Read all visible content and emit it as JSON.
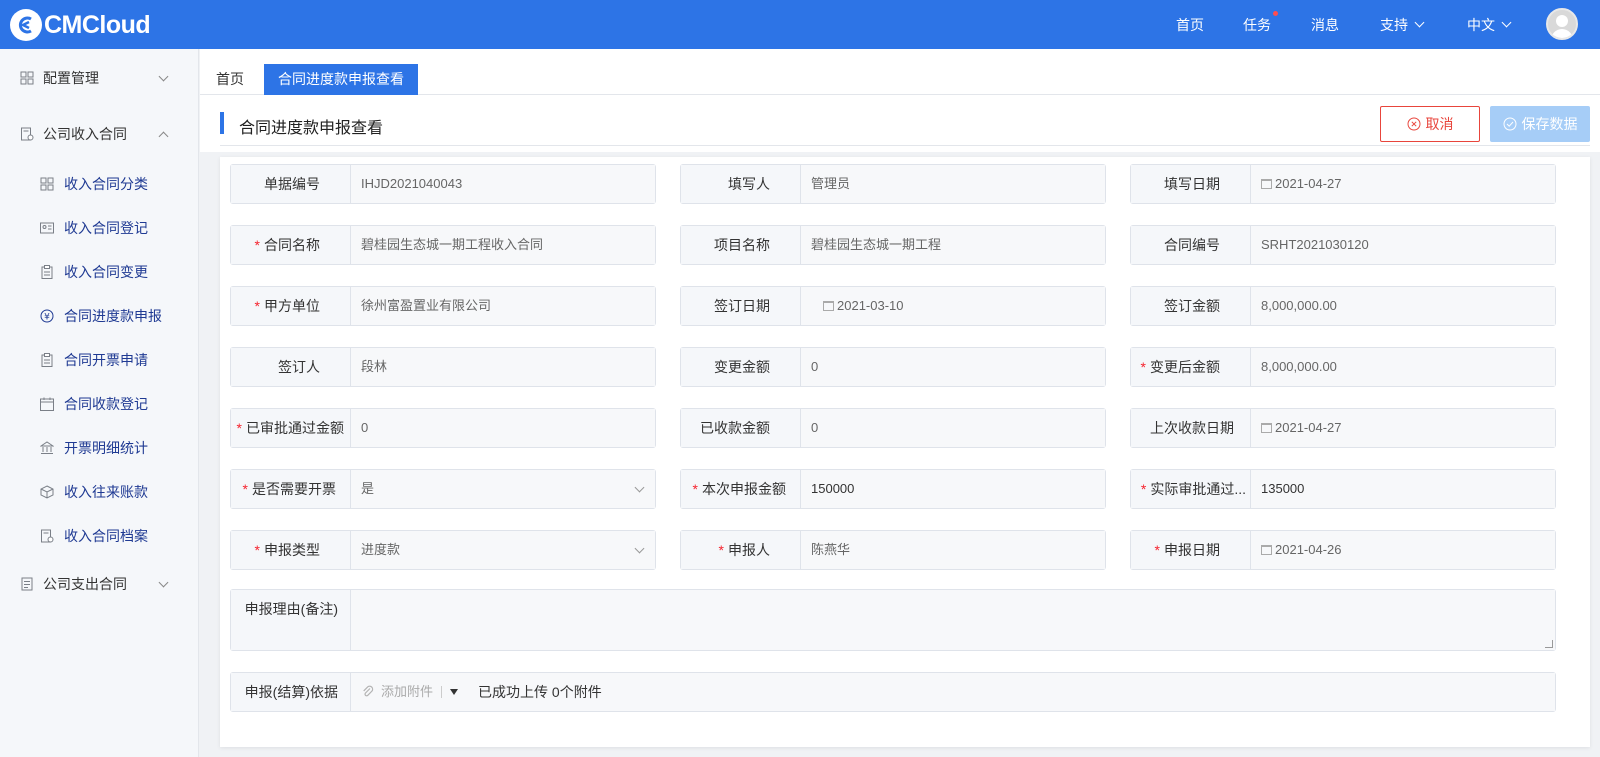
{
  "app": {
    "brand": "CMCloud"
  },
  "topnav": {
    "home": "首页",
    "tasks": "任务",
    "messages": "消息",
    "support": "支持",
    "language": "中文"
  },
  "sidebar": {
    "group1": "配置管理",
    "group2": "公司收入合同",
    "items": [
      "收入合同分类",
      "收入合同登记",
      "收入合同变更",
      "合同进度款申报",
      "合同开票申请",
      "合同收款登记",
      "开票明细统计",
      "收入往来账款",
      "收入合同档案"
    ],
    "group3": "公司支出合同"
  },
  "tabs": {
    "home": "首页",
    "active": "合同进度款申报查看"
  },
  "page": {
    "title": "合同进度款申报查看",
    "cancel": "取消",
    "save": "保存数据"
  },
  "form": {
    "doc_no_label": "单据编号",
    "doc_no": "IHJD2021040043",
    "writer_label": "填写人",
    "writer": "管理员",
    "write_date_label": "填写日期",
    "write_date": "2021-04-27",
    "contract_name_label": "合同名称",
    "contract_name": "碧桂园生态城一期工程收入合同",
    "project_name_label": "项目名称",
    "project_name": "碧桂园生态城一期工程",
    "contract_no_label": "合同编号",
    "contract_no": "SRHT2021030120",
    "party_a_label": "甲方单位",
    "party_a": "徐州富盈置业有限公司",
    "sign_date_label": "签订日期",
    "sign_date": "2021-03-10",
    "sign_amount_label": "签订金额",
    "sign_amount": "8,000,000.00",
    "signer_label": "签订人",
    "signer": "段林",
    "change_amount_label": "变更金额",
    "change_amount": "0",
    "after_change_label": "变更后金额",
    "after_change": "8,000,000.00",
    "approved_amount_label": "已审批通过金额",
    "approved_amount": "0",
    "received_amount_label": "已收款金额",
    "received_amount": "0",
    "last_receive_date_label": "上次收款日期",
    "last_receive_date": "2021-04-27",
    "need_invoice_label": "是否需要开票",
    "need_invoice": "是",
    "current_amount_label": "本次申报金额",
    "current_amount": "150000",
    "actual_approved_label": "实际审批通过...",
    "actual_approved": "135000",
    "report_type_label": "申报类型",
    "report_type": "进度款",
    "reporter_label": "申报人",
    "reporter": "陈燕华",
    "report_date_label": "申报日期",
    "report_date": "2021-04-26",
    "reason_label": "申报理由(备注)",
    "reason": "",
    "basis_label": "申报(结算)依据",
    "add_attachment": "添加附件",
    "upload_info": "已成功上传 0个附件"
  }
}
